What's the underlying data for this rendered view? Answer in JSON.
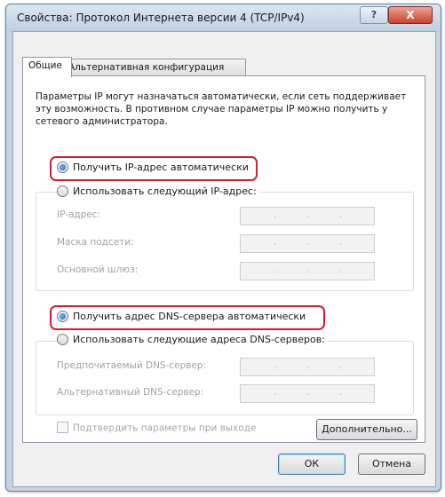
{
  "window": {
    "title": "Свойства: Протокол Интернета версии 4 (TCP/IPv4)",
    "help_label": "?",
    "close_label": "X"
  },
  "tabs": [
    {
      "label": "Общие",
      "active": true
    },
    {
      "label": "Альтернативная конфигурация",
      "active": false
    }
  ],
  "description": "Параметры IP могут назначаться автоматически, если сеть поддерживает эту возможность. В противном случае параметры IP можно получить у сетевого администратора.",
  "ip": {
    "auto_label": "Получить IP-адрес автоматически",
    "auto_selected": true,
    "manual_label": "Использовать следующий IP-адрес:",
    "manual_selected": false,
    "fields": [
      {
        "label": "IP-адрес:",
        "value": ""
      },
      {
        "label": "Маска подсети:",
        "value": ""
      },
      {
        "label": "Основной шлюз:",
        "value": ""
      }
    ]
  },
  "dns": {
    "auto_label": "Получить адрес DNS-сервера автоматически",
    "auto_selected": true,
    "manual_label": "Использовать следующие адреса DNS-серверов:",
    "manual_selected": false,
    "fields": [
      {
        "label": "Предпочитаемый DNS-сервер:",
        "value": ""
      },
      {
        "label": "Альтернативный DNS-сервер:",
        "value": ""
      }
    ]
  },
  "validate_checkbox": {
    "label": "Подтвердить параметры при выходе",
    "checked": false
  },
  "buttons": {
    "advanced": "Дополнительно...",
    "ok": "ОК",
    "cancel": "Отмена"
  },
  "colors": {
    "highlight": "#d0202f",
    "titlebar": "#c3d3e4",
    "close_button": "#c8412b"
  }
}
